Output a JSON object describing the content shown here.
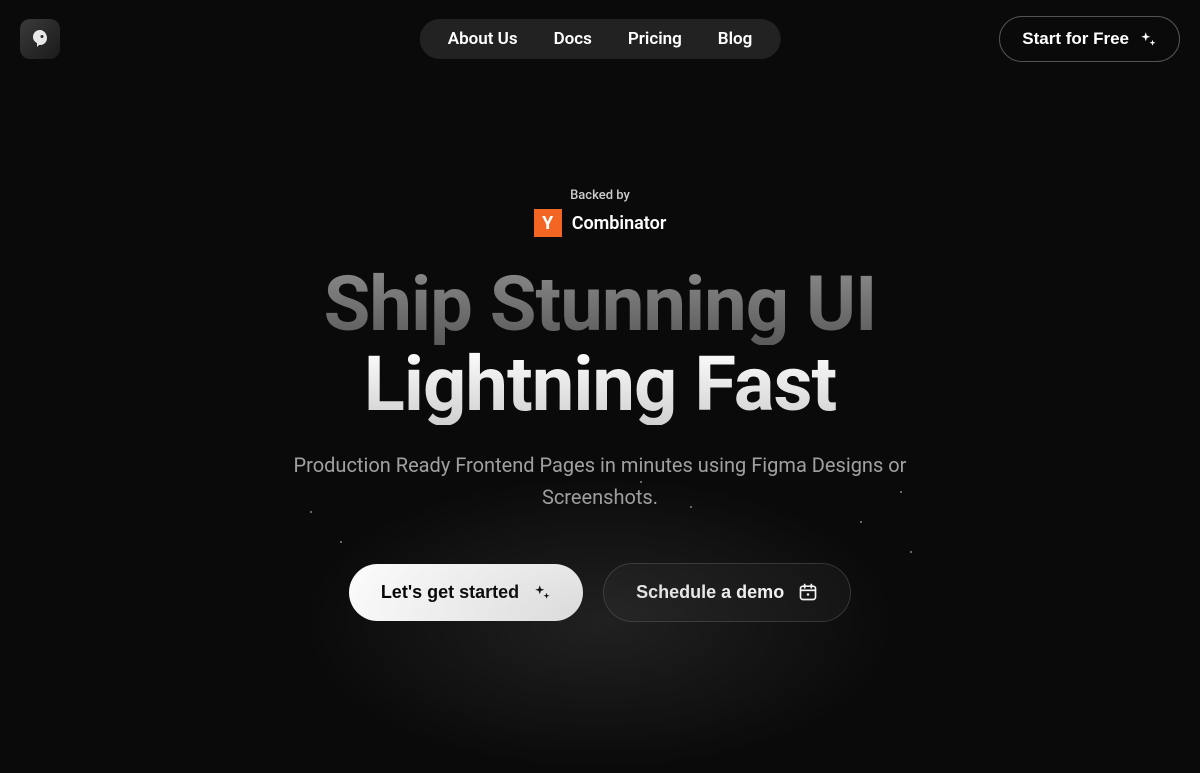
{
  "nav": {
    "items": [
      {
        "label": "About Us"
      },
      {
        "label": "Docs"
      },
      {
        "label": "Pricing"
      },
      {
        "label": "Blog"
      }
    ]
  },
  "header_cta": {
    "label": "Start for Free"
  },
  "backed_by": {
    "label": "Backed by",
    "yc_letter": "Y",
    "yc_name": "Combinator"
  },
  "hero": {
    "headline_line1": "Ship Stunning UI",
    "headline_line2": "Lightning Fast",
    "subheadline": "Production Ready Frontend Pages in minutes using Figma Designs or Screenshots."
  },
  "cta": {
    "primary_label": "Let's get started",
    "secondary_label": "Schedule a demo"
  }
}
